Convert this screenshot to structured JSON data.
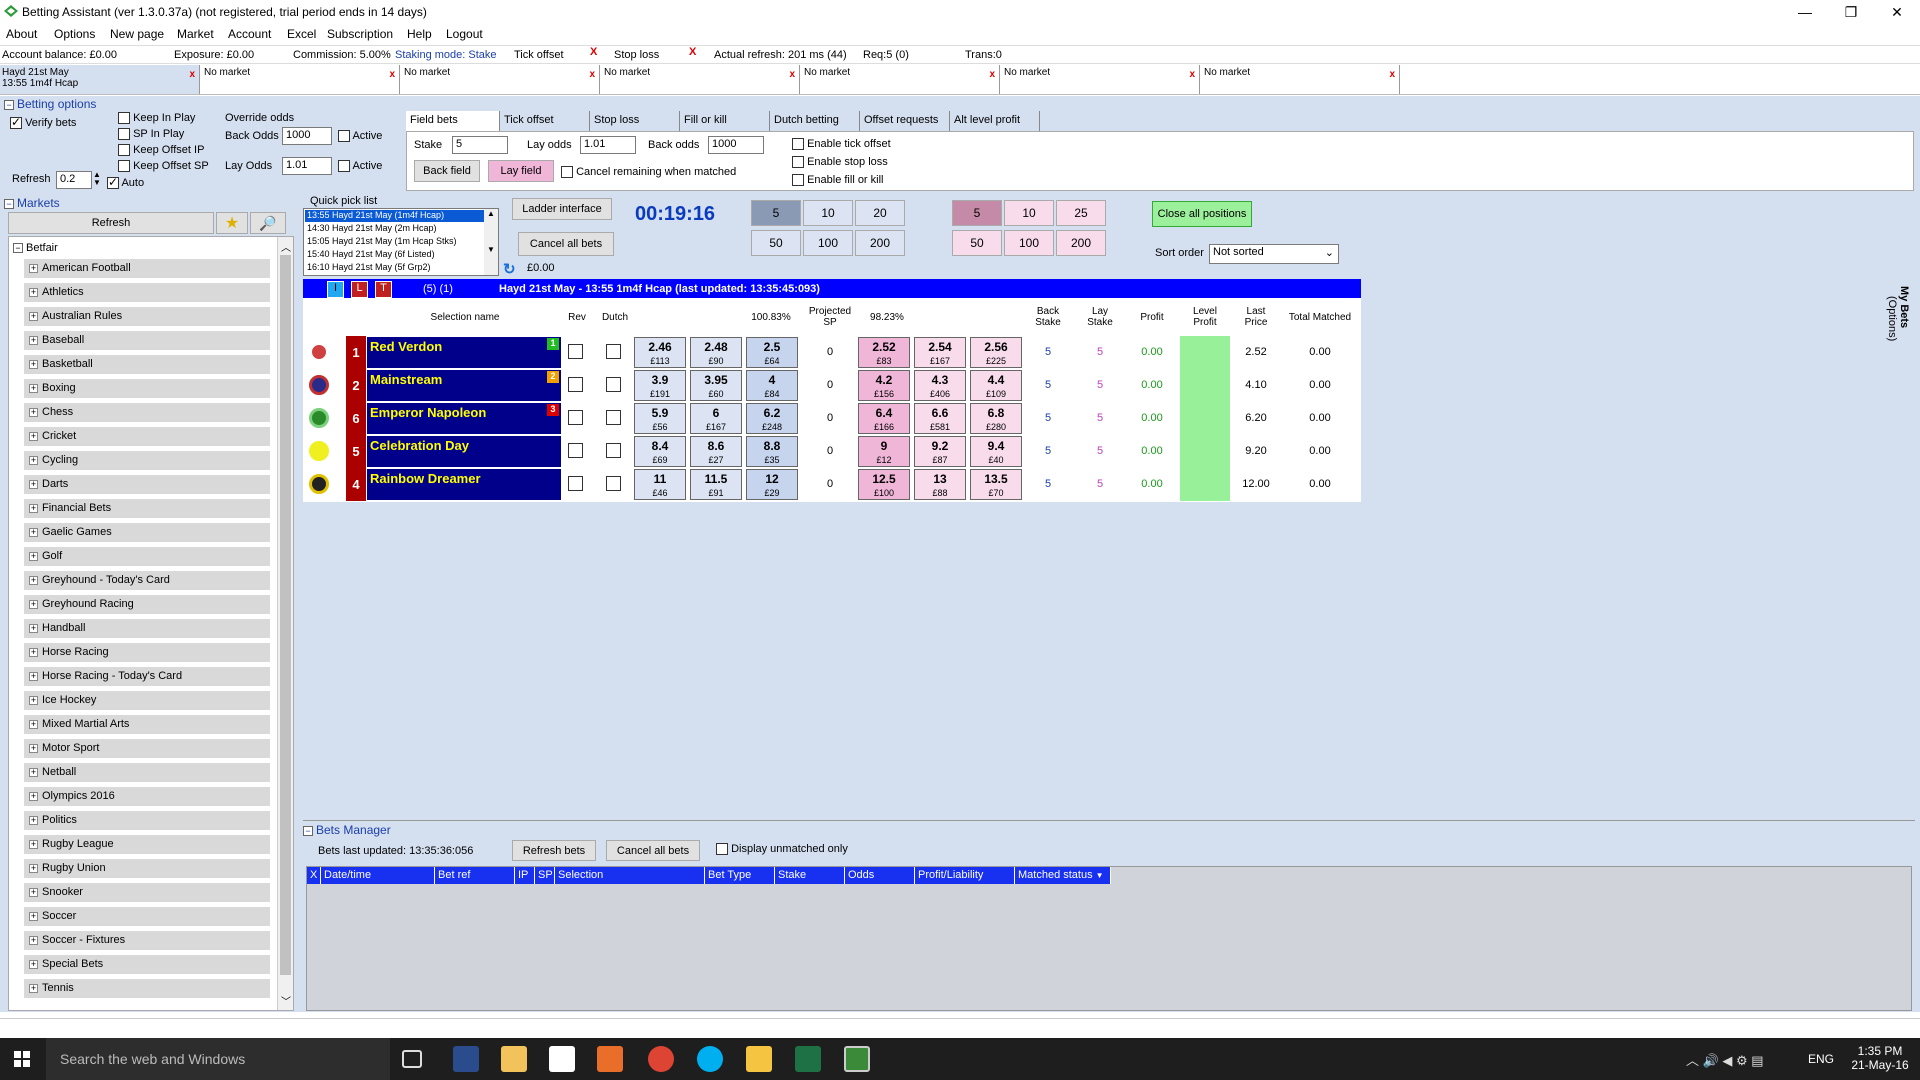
{
  "window": {
    "title": "Betting Assistant (ver 1.3.0.37a)     (not registered, trial period ends in 14 days)"
  },
  "menu": [
    "About",
    "Options",
    "New page",
    "Market",
    "Account",
    "Excel",
    "Subscription",
    "Help",
    "Logout"
  ],
  "status": {
    "balance": "Account balance: £0.00",
    "exposure": "Exposure: £0.00",
    "commission": "Commission: 5.00%",
    "staking": "Staking mode: Stake",
    "tick_offset": "Tick offset",
    "stop_loss": "Stop loss",
    "refresh": "Actual refresh: 201 ms (44)",
    "req": "Req:5 (0)",
    "trans": "Trans:0",
    "x": "X"
  },
  "market_tabs": [
    {
      "line1": "Hayd 21st May",
      "line2": "13:55 1m4f Hcap"
    },
    {
      "line1": "No market",
      "line2": ""
    },
    {
      "line1": "No market",
      "line2": ""
    },
    {
      "line1": "No market",
      "line2": ""
    },
    {
      "line1": "No market",
      "line2": ""
    },
    {
      "line1": "No market",
      "line2": ""
    },
    {
      "line1": "No market",
      "line2": ""
    }
  ],
  "betting_options": {
    "title": "Betting options",
    "verify_bets": "Verify bets",
    "keep_in_play": "Keep In Play",
    "sp_in_play": "SP In Play",
    "keep_offset_ip": "Keep Offset IP",
    "keep_offset_sp": "Keep Offset SP",
    "override_odds": "Override odds",
    "back_odds_label": "Back Odds",
    "back_odds_value": "1000",
    "lay_odds_label": "Lay Odds",
    "lay_odds_value": "1.01",
    "active": "Active",
    "refresh_label": "Refresh",
    "refresh_value": "0.2",
    "auto": "Auto"
  },
  "field_bets": {
    "tabs": [
      "Field bets",
      "Tick offset",
      "Stop loss",
      "Fill or kill",
      "Dutch betting",
      "Offset requests",
      "Alt level profit"
    ],
    "stake_label": "Stake",
    "stake_value": "5",
    "lay_odds_label": "Lay odds",
    "lay_odds_value": "1.01",
    "back_odds_label": "Back odds",
    "back_odds_value": "1000",
    "back_field": "Back field",
    "lay_field": "Lay field",
    "cancel_remaining": "Cancel remaining when matched",
    "enable_tick": "Enable tick offset",
    "enable_stop": "Enable stop loss",
    "enable_fill": "Enable fill or kill"
  },
  "markets": {
    "title": "Markets",
    "refresh": "Refresh",
    "root": "Betfair",
    "items": [
      "American Football",
      "Athletics",
      "Australian Rules",
      "Baseball",
      "Basketball",
      "Boxing",
      "Chess",
      "Cricket",
      "Cycling",
      "Darts",
      "Financial Bets",
      "Gaelic Games",
      "Golf",
      "Greyhound - Today's Card",
      "Greyhound Racing",
      "Handball",
      "Horse Racing",
      "Horse Racing - Today's Card",
      "Ice Hockey",
      "Mixed Martial Arts",
      "Motor Sport",
      "Netball",
      "Olympics 2016",
      "Politics",
      "Rugby League",
      "Rugby Union",
      "Snooker",
      "Soccer",
      "Soccer - Fixtures",
      "Special Bets",
      "Tennis"
    ]
  },
  "quick_pick": {
    "title": "Quick pick list",
    "items": [
      "13:55 Hayd 21st May (1m4f Hcap)",
      "14:30 Hayd 21st May (2m Hcap)",
      "15:05 Hayd 21st May (1m Hcap Stks)",
      "15:40 Hayd 21st May (6f Listed)",
      "16:10 Hayd 21st May (5f Grp2)"
    ]
  },
  "controls": {
    "ladder": "Ladder interface",
    "cancel_all": "Cancel all bets",
    "amount": "£0.00",
    "timer": "00:19:16",
    "back_stakes": [
      "5",
      "10",
      "20",
      "50",
      "100",
      "200"
    ],
    "lay_stakes": [
      "5",
      "10",
      "25",
      "50",
      "100",
      "200"
    ],
    "close_all": "Close all positions",
    "sort_order": "Sort order",
    "sort_value": "Not sorted"
  },
  "market_header": {
    "i": "I",
    "l": "L",
    "t": "T",
    "count": "(5) (1)",
    "title": "Hayd 21st May - 13:55 1m4f Hcap (last updated: 13:35:45:093)"
  },
  "grid_headers": {
    "selection": "Selection name",
    "rev": "Rev",
    "dutch": "Dutch",
    "back_pct": "100.83%",
    "projected_sp": "Projected SP",
    "lay_pct": "98.23%",
    "back_stake": "Back Stake",
    "lay_stake": "Lay Stake",
    "profit": "Profit",
    "level_profit": "Level Profit",
    "last_price": "Last Price",
    "total_matched": "Total Matched"
  },
  "runners": [
    {
      "num": "1",
      "name": "Red Verdon",
      "badge": "1",
      "badge_color": "#22bb22",
      "back": [
        [
          "2.46",
          "£113"
        ],
        [
          "2.48",
          "£90"
        ],
        [
          "2.5",
          "£64"
        ]
      ],
      "proj": "0",
      "lay": [
        [
          "2.52",
          "£83"
        ],
        [
          "2.54",
          "£167"
        ],
        [
          "2.56",
          "£225"
        ]
      ],
      "bs": "5",
      "ls": "5",
      "profit": "0.00",
      "last": "2.52",
      "matched": "0.00"
    },
    {
      "num": "2",
      "name": "Mainstream",
      "badge": "2",
      "badge_color": "#f0a000",
      "back": [
        [
          "3.9",
          "£191"
        ],
        [
          "3.95",
          "£60"
        ],
        [
          "4",
          "£84"
        ]
      ],
      "proj": "0",
      "lay": [
        [
          "4.2",
          "£156"
        ],
        [
          "4.3",
          "£406"
        ],
        [
          "4.4",
          "£109"
        ]
      ],
      "bs": "5",
      "ls": "5",
      "profit": "0.00",
      "last": "4.10",
      "matched": "0.00"
    },
    {
      "num": "6",
      "name": "Emperor Napoleon",
      "badge": "3",
      "badge_color": "#dd0000",
      "back": [
        [
          "5.9",
          "£56"
        ],
        [
          "6",
          "£167"
        ],
        [
          "6.2",
          "£248"
        ]
      ],
      "proj": "0",
      "lay": [
        [
          "6.4",
          "£166"
        ],
        [
          "6.6",
          "£581"
        ],
        [
          "6.8",
          "£280"
        ]
      ],
      "bs": "5",
      "ls": "5",
      "profit": "0.00",
      "last": "6.20",
      "matched": "0.00"
    },
    {
      "num": "5",
      "name": "Celebration Day",
      "badge": "",
      "badge_color": "",
      "back": [
        [
          "8.4",
          "£69"
        ],
        [
          "8.6",
          "£27"
        ],
        [
          "8.8",
          "£35"
        ]
      ],
      "proj": "0",
      "lay": [
        [
          "9",
          "£12"
        ],
        [
          "9.2",
          "£87"
        ],
        [
          "9.4",
          "£40"
        ]
      ],
      "bs": "5",
      "ls": "5",
      "profit": "0.00",
      "last": "9.20",
      "matched": "0.00"
    },
    {
      "num": "4",
      "name": "Rainbow Dreamer",
      "badge": "",
      "badge_color": "",
      "back": [
        [
          "11",
          "£46"
        ],
        [
          "11.5",
          "£91"
        ],
        [
          "12",
          "£29"
        ]
      ],
      "proj": "0",
      "lay": [
        [
          "12.5",
          "£100"
        ],
        [
          "13",
          "£88"
        ],
        [
          "13.5",
          "£70"
        ]
      ],
      "bs": "5",
      "ls": "5",
      "profit": "0.00",
      "last": "12.00",
      "matched": "0.00"
    }
  ],
  "bets_manager": {
    "title": "Bets Manager",
    "last_updated": "Bets last updated: 13:35:36:056",
    "refresh": "Refresh bets",
    "cancel": "Cancel all bets",
    "display_unmatched": "Display unmatched only",
    "columns": [
      "X",
      "Date/time",
      "Bet ref",
      "IP",
      "SP",
      "Selection",
      "Bet Type",
      "Stake",
      "Odds",
      "Profit/Liability",
      "Matched status"
    ]
  },
  "right_panel": {
    "my_bets": "My Bets",
    "options": "(Options)"
  },
  "taskbar": {
    "search": "Search the web and Windows",
    "lang": "ENG",
    "time": "1:35 PM",
    "date": "21-May-16"
  },
  "colors": {
    "accent_blue": "#0000ff",
    "back": "#c6d4ee",
    "lay": "#f0b6d8",
    "panel": "#d4dff0"
  }
}
